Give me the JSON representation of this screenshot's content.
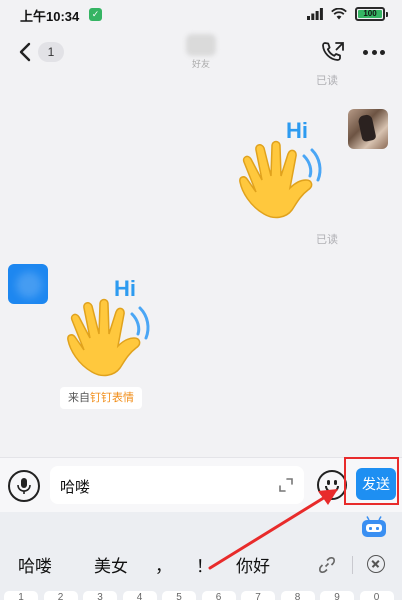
{
  "status_bar": {
    "time": "上午10:34",
    "battery_level": "100",
    "app_icon_glyph": "✓",
    "colors": {
      "battery_fill": "#35b463"
    }
  },
  "header": {
    "unread_count": "1",
    "contact_subtitle": "好友"
  },
  "chat": {
    "read_receipt_1": "已读",
    "read_receipt_2": "已读",
    "sticker_caption_1": "Hi",
    "sticker_caption_2": "Hi",
    "source_prefix": "来自",
    "source_link": "钉钉表情",
    "sticker_type": "waving-hand-emoji"
  },
  "input_bar": {
    "text_value": "哈喽",
    "send_label": "发送",
    "colors": {
      "send_button": "#1e8ff2",
      "highlight_box": "#e82b2b"
    }
  },
  "keyboard": {
    "candidates": [
      "哈喽",
      "美女",
      "，",
      "！",
      "你好"
    ],
    "number_keys": [
      "1",
      "2",
      "3",
      "4",
      "5",
      "6",
      "7",
      "8",
      "9",
      "0"
    ]
  }
}
